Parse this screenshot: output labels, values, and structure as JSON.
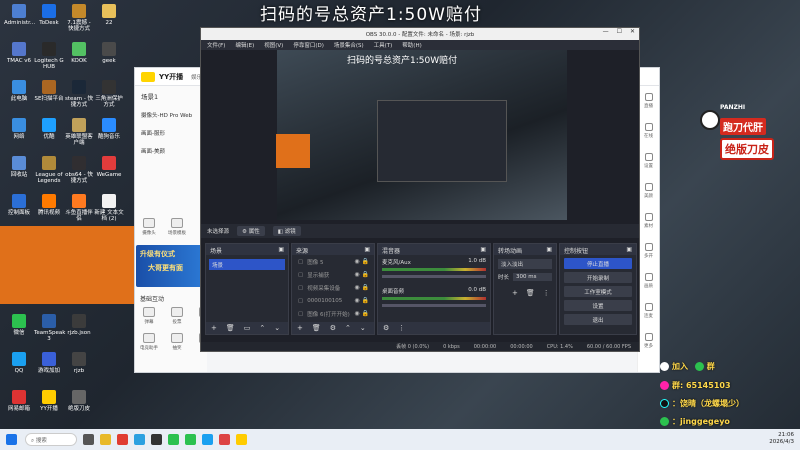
{
  "headline": "扫码的号总资产1:50W赔付",
  "desktop_icons": [
    {
      "label": "Administr...",
      "color": "#4d7fd1"
    },
    {
      "label": "ToDesk",
      "color": "#1b6ee6"
    },
    {
      "label": "7.1震撼 - 快捷方式",
      "color": "#c4892a"
    },
    {
      "label": "22",
      "color": "#e8c05a"
    },
    {
      "label": "TMAC v6",
      "color": "#5577cc"
    },
    {
      "label": "Logitech G HUB",
      "color": "#2a2a2a"
    },
    {
      "label": "KOOK",
      "color": "#53c163"
    },
    {
      "label": "geek",
      "color": "#4a4a4a"
    },
    {
      "label": "此电脑",
      "color": "#3a8ee0"
    },
    {
      "label": "SE扫描平台",
      "color": "#a62"
    },
    {
      "label": "steam - 快捷方式",
      "color": "#1b2838"
    },
    {
      "label": "三角洲保护方式",
      "color": "#333"
    },
    {
      "label": "网络",
      "color": "#3a8ee0"
    },
    {
      "label": "优酷",
      "color": "#1ea0ff"
    },
    {
      "label": "英雄联盟客户端",
      "color": "#c0a15a"
    },
    {
      "label": "酷狗音乐",
      "color": "#2a8cff"
    },
    {
      "label": "回收站",
      "color": "#5a8cd6"
    },
    {
      "label": "League of Legends",
      "color": "#b08a3a"
    },
    {
      "label": "obs64 - 快捷方式",
      "color": "#302e31"
    },
    {
      "label": "WeGame",
      "color": "#e23c3c"
    },
    {
      "label": "控制面板",
      "color": "#2b6fd6"
    },
    {
      "label": "腾讯视频",
      "color": "#ff7a00"
    },
    {
      "label": "斗鱼直播伴侣",
      "color": "#ff7a20"
    },
    {
      "label": "新建 文本文档 (2)",
      "color": "#f2f2f2"
    },
    {
      "label": "UU加速器",
      "color": "#2a6ad8"
    },
    {
      "label": "Microsoft",
      "color": "#0a7ad8"
    },
    {
      "label": "新建 文本文",
      "color": "#f2f2f2"
    },
    {
      "label": "新建 文本文档",
      "color": "#f2f2f2"
    },
    {
      "label": "微信",
      "color": "#2cc14f"
    },
    {
      "label": "TeamSpeak 3",
      "color": "#2b5ea8"
    },
    {
      "label": "rjzb.json",
      "color": "#3b3b3b"
    },
    {
      "label": "QQ",
      "color": "#1aa0f0"
    },
    {
      "label": "游戏加加",
      "color": "#3a60d8"
    },
    {
      "label": "rjzb",
      "color": "#444"
    },
    {
      "label": "网易邮箱",
      "color": "#d33"
    },
    {
      "label": "YY开播",
      "color": "#ffcc00"
    },
    {
      "label": "绝版刀皮",
      "color": "#666"
    }
  ],
  "yy": {
    "app_name": "YY开播",
    "tab_label": "娱乐",
    "scene_label": "场景1",
    "sources": [
      "摄像头-HD Pro Web",
      "画面-服形",
      "画面-美颜"
    ],
    "banner_line1": "升级有仪式",
    "banner_line2": "大哥更有面",
    "section_basic": "基础互动",
    "tools_row1": [
      "摄像头",
      "场景模板"
    ],
    "tools_row2": [
      "弹幕",
      "投票",
      "点歌"
    ],
    "tools_row3": [
      "电竞助手",
      "抽奖",
      "数据",
      "画面设置"
    ],
    "right_items": [
      "直播",
      "在线",
      "设置",
      "美颜",
      "素材",
      "多开",
      "画质",
      "连麦",
      "更多"
    ]
  },
  "obs": {
    "title": "OBS 30.0.0 - 配置文件: 未命名 - 场景: rjzb",
    "menu": [
      "文件(F)",
      "编辑(E)",
      "视图(V)",
      "停靠窗口(D)",
      "场景集合(S)",
      "工具(T)",
      "帮助(H)"
    ],
    "preview_title": "扫码的号总资产1:50W赔付",
    "no_source": "未选择源",
    "properties_btn": "属性",
    "filters_btn": "滤镜",
    "scenes_header": "场景",
    "scenes": [
      "场景"
    ],
    "sources_header": "来源",
    "sources": [
      "图像 5",
      "显示捕获",
      "视频采集设备",
      "0000100105",
      "图像 6(打开开始)"
    ],
    "mixer_header": "混音器",
    "mixer": [
      {
        "name": "麦克风/Aux",
        "db": "1.0 dB"
      },
      {
        "name": "桌面音频",
        "db": "0.0 dB"
      }
    ],
    "transitions_header": "转场动画",
    "transition_type": "淡入淡出",
    "duration_label": "时长",
    "duration_value": "300 ms",
    "controls_header": "控制按钮",
    "controls": [
      "停止直播",
      "开始录制",
      "工作室模式",
      "设置",
      "退出"
    ],
    "status": {
      "frames": "丢帧 0 (0.0%)",
      "bitrate": "0 kbps",
      "stream_time": "00:00:00",
      "rec_time": "00:00:00",
      "cpu": "CPU: 1.4%",
      "fps": "60.00 / 60.00 FPS"
    }
  },
  "overlay": {
    "brand": "PANZHI",
    "tag1": "跑刀代肝",
    "tag2": "绝版刀皮",
    "join": "加入",
    "group_label": "群",
    "group_number": "群: 65145103",
    "douyin": "：饶晴（龙螺塌少）",
    "wechat": "：jinggegeyo"
  },
  "taskbar": {
    "search_placeholder": "搜索",
    "time": "21:06",
    "date": "2026/4/3"
  }
}
